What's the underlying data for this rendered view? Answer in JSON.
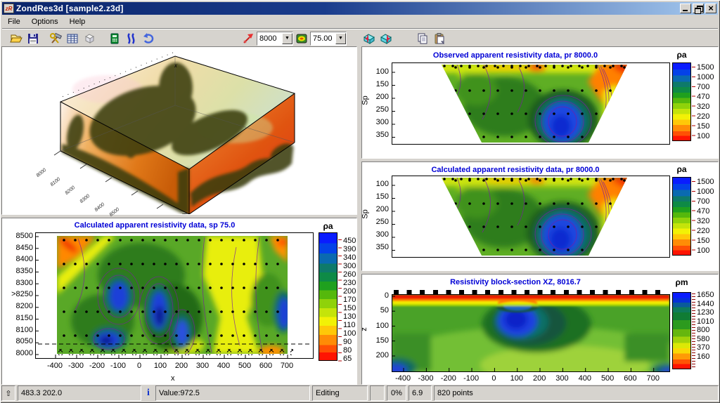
{
  "window": {
    "title": "ZondRes3d [sample2.z3d]",
    "icon_text": "zR"
  },
  "menu": {
    "items": [
      "File",
      "Options",
      "Help"
    ]
  },
  "toolbar": {
    "pr_value": "8000",
    "sp_value": "75.00",
    "dropdown_glyph": "▼"
  },
  "view3d": {
    "corner_label": "x",
    "axis_labels": [
      "8000",
      "8100",
      "8200",
      "8300",
      "8400",
      "8500"
    ]
  },
  "charts": {
    "observed": {
      "title": "Observed apparent resistivity data, pr 8000.0",
      "ylabel": "Sp",
      "yticks": [
        "100",
        "150",
        "200",
        "250",
        "300",
        "350"
      ],
      "colorbar": {
        "title": "ρa",
        "labels": [
          "1500",
          "1000",
          "700",
          "470",
          "320",
          "220",
          "150",
          "100"
        ]
      }
    },
    "calculated": {
      "title": "Calculated apparent resistivity data, pr 8000.0",
      "ylabel": "Sp",
      "yticks": [
        "100",
        "150",
        "200",
        "250",
        "300",
        "350"
      ],
      "colorbar": {
        "title": "ρa",
        "labels": [
          "1500",
          "1000",
          "700",
          "470",
          "320",
          "220",
          "150",
          "100"
        ]
      }
    },
    "block": {
      "title": "Resistivity block-section XZ, 8016.7",
      "ylabel": "z",
      "yticks": [
        "0",
        "50",
        "100",
        "150",
        "200"
      ],
      "xticks": [
        "-400",
        "-300",
        "-200",
        "-100",
        "0",
        "100",
        "200",
        "300",
        "400",
        "500",
        "600",
        "700"
      ],
      "colorbar": {
        "title": "ρm",
        "labels": [
          "1650",
          "1440",
          "1230",
          "1010",
          "800",
          "580",
          "370",
          "160"
        ]
      }
    },
    "sp_section": {
      "title": "Calculated apparent resistivity data, sp 75.0",
      "xlabel": "x",
      "yticks": [
        "8500",
        "8450",
        "8400",
        "8350",
        "8300",
        ">8250",
        "8200",
        "8150",
        "8100",
        "8050",
        "8000"
      ],
      "xticks": [
        "-400",
        "-300",
        "-200",
        "-100",
        "0",
        "100",
        "200",
        "300",
        "400",
        "500",
        "600",
        "700"
      ],
      "colorbar": {
        "title": "ρa",
        "labels": [
          "450",
          "390",
          "340",
          "300",
          "260",
          "230",
          "200",
          "170",
          "150",
          "130",
          "110",
          "100",
          "90",
          "80",
          "65"
        ]
      }
    }
  },
  "statusbar": {
    "coords": "483.3 202.0",
    "value": "Value:972.5",
    "mode": "Editing",
    "percent": "0%",
    "scale": "6.9",
    "points": "820 points"
  },
  "colors": {
    "titlebar_start": "#0a246a",
    "titlebar_end": "#a6caf0",
    "chrome": "#d6d3ce",
    "chart_title": "#0000d6"
  }
}
